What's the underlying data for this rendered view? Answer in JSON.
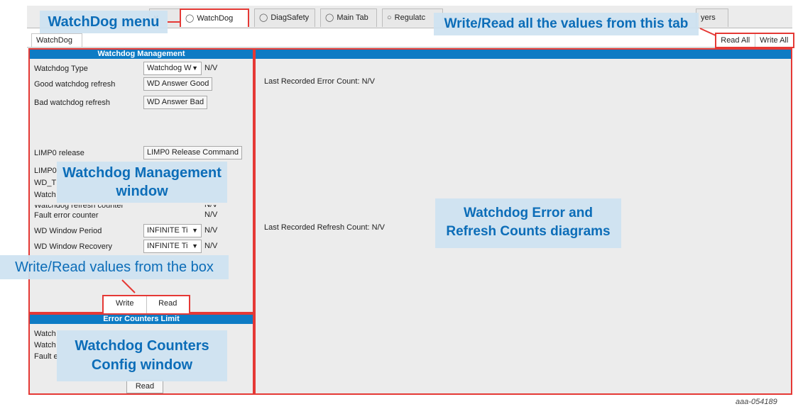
{
  "tabs": [
    {
      "label": "WatchDog",
      "icon": "shield-icon",
      "active": true
    },
    {
      "label": "DiagSafety",
      "icon": "shield-icon",
      "active": false
    },
    {
      "label": "Main Tab",
      "icon": "shield-icon",
      "active": false
    },
    {
      "label": "Regulatc",
      "icon": "circle-icon",
      "active": false
    },
    {
      "label": "yers",
      "icon": "",
      "active": false
    }
  ],
  "partial_tab_left": "y",
  "subtab": "WatchDog",
  "toolbar": {
    "read_all": "Read All",
    "write_all": "Write All"
  },
  "wd_panel": {
    "title": "Watchdog Management",
    "watchdog_type_label": "Watchdog Type",
    "watchdog_type_value": "Watchdog W",
    "watchdog_type_status": "N/V",
    "good_refresh_label": "Good watchdog refresh",
    "good_refresh_button": "WD Answer Good",
    "bad_refresh_label": "Bad watchdog refresh",
    "bad_refresh_button": "WD Answer Bad",
    "limp0_release_label": "LIMP0 release",
    "limp0_release_button": "LIMP0 Release Command",
    "limp0_partial": "LIMP0",
    "wdt_partial": "WD_T",
    "watch_partial": "Watch",
    "watchdog_refresh_counter_label": "Watchdog refresh counter",
    "watchdog_refresh_counter_status": "N/V",
    "fault_error_counter_label": "Fault error counter",
    "fault_error_counter_status": "N/V",
    "wd_window_period_label": "WD Window Period",
    "wd_window_period_value": "INFINITE Ti",
    "wd_window_period_status": "N/V",
    "wd_window_recovery_label": "WD Window Recovery",
    "wd_window_recovery_value": "INFINITE Ti",
    "wd_window_recovery_status": "N/V",
    "write_label": "Write",
    "read_label": "Read"
  },
  "err_panel": {
    "title": "Error Counters Limit",
    "row1_partial": "Watch",
    "row2_partial": "Watch",
    "row3_partial": "Fault e",
    "read_label": "Read"
  },
  "diagram_panel": {
    "error_count_label": "Last Recorded Error Count:",
    "error_count_value": "N/V",
    "refresh_count_label": "Last Recorded Refresh Count:",
    "refresh_count_value": "N/V"
  },
  "callouts": {
    "watchdog_menu": "WatchDog menu",
    "write_read_all": "Write/Read all the values from this tab",
    "wd_mgmt_line1": "Watchdog Management",
    "wd_mgmt_line2": "window",
    "write_read_box": "Write/Read values from the box",
    "counters_line1": "Watchdog Counters",
    "counters_line2": "Config window",
    "diagrams_line1": "Watchdog Error and",
    "diagrams_line2": "Refresh Counts diagrams"
  },
  "figure_id": "aaa-054189",
  "colors": {
    "accent": "#0e7bc4",
    "highlight": "#e53935",
    "callout_bg": "#cde2f1",
    "callout_text": "#0c6db8"
  }
}
